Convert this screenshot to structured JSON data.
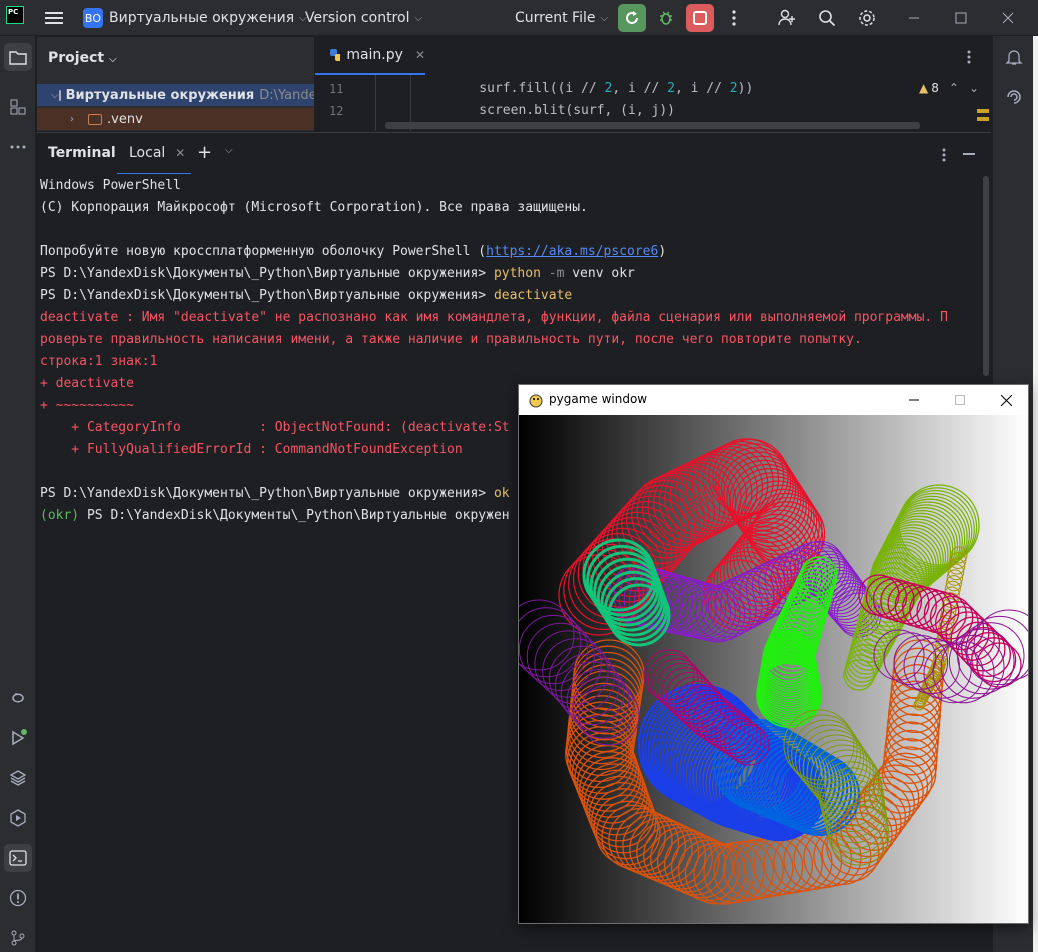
{
  "titlebar": {
    "logo_text": "PC",
    "project_badge": "ВО",
    "project_name": "Виртуальные окружения",
    "vcs_label": "Version control",
    "run_config": "Current File",
    "icons": [
      "hamburger-menu-icon",
      "rerun-icon",
      "debug-icon",
      "stop-icon",
      "more-vertical-icon",
      "add-user-icon",
      "search-icon",
      "settings-icon",
      "minimize-icon",
      "maximize-icon",
      "close-icon"
    ]
  },
  "project_panel": {
    "title": "Project",
    "root_name": "Виртуальные окружения",
    "root_path": "D:\\Yandex",
    "venv_name": ".venv"
  },
  "editor": {
    "tab_label": "main.py",
    "warnings_count": "8",
    "lines": [
      {
        "number": "11",
        "pre": "    surf.fill((i // ",
        "n1": "2",
        "mid1": ", i // ",
        "n2": "2",
        "mid2": ", i // ",
        "n3": "2",
        "post": "))"
      },
      {
        "number": "12",
        "text": "    screen.blit(surf, (i, j))"
      }
    ]
  },
  "terminal": {
    "title": "Terminal",
    "tab_label": "Local",
    "lines": {
      "l1": "Windows PowerShell",
      "l2": "(C) Корпорация Майкрософт (Microsoft Corporation). Все права защищены.",
      "l3_pre": "Попробуйте новую кроссплатформенную оболочку PowerShell (",
      "l3_link": "https://aka.ms/pscore6",
      "l3_post": ")",
      "prompt": "PS D:\\YandexDisk\\Документы\\_Python\\Виртуальные окружения> ",
      "cmd1_a": "python",
      "cmd1_b": " -m",
      "cmd1_c": " venv okr",
      "cmd2": "deactivate",
      "err1": "deactivate : Имя \"deactivate\" не распознано как имя командлета, функции, файла сценария или выполняемой программы. П",
      "err2": "роверьте правильность написания имени, а также наличие и правильность пути, после чего повторите попытку.",
      "err3": "строка:1 знак:1",
      "err4": "+ deactivate",
      "err5": "+ ~~~~~~~~~~",
      "err6": "    + CategoryInfo          : ObjectNotFound: (deactivate:St",
      "err7": "    + FullyQualifiedErrorId : CommandNotFoundException",
      "cmd3": "ok",
      "venv_prefix": "(okr)",
      "last_prompt": " PS D:\\YandexDisk\\Документы\\_Python\\Виртуальные окружен"
    }
  },
  "pygame_window": {
    "title": "pygame window"
  }
}
